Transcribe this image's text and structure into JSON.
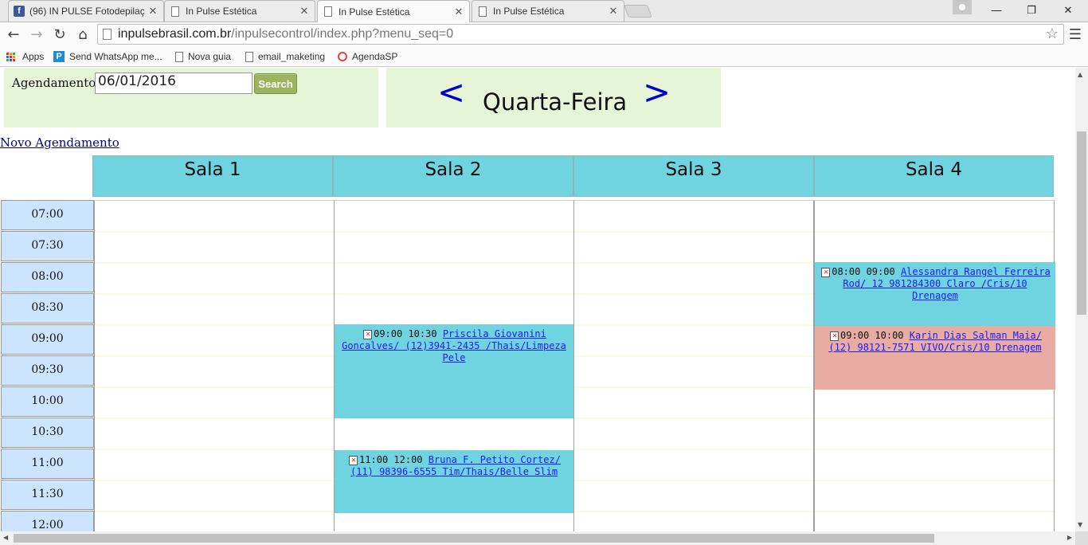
{
  "browser": {
    "tabs": [
      {
        "label": "(96) IN PULSE Fotodepilaç",
        "icon": "facebook-icon",
        "active": false
      },
      {
        "label": "In Pulse Estética",
        "icon": "page-icon",
        "active": false
      },
      {
        "label": "In Pulse Estética",
        "icon": "page-icon",
        "active": true
      },
      {
        "label": "In Pulse Estética",
        "icon": "page-icon",
        "active": false
      }
    ],
    "url_domain": "inpulsebrasil.com.br",
    "url_path": "/inpulsecontrol/index.php?menu_seq=0",
    "bookmarks": [
      {
        "label": "Apps",
        "icon": "apps-icon"
      },
      {
        "label": "Send WhatsApp me...",
        "icon": "p-icon"
      },
      {
        "label": "Nova guia",
        "icon": "page-icon"
      },
      {
        "label": "email_maketing",
        "icon": "page-icon"
      },
      {
        "label": "AgendaSP",
        "icon": "clock-icon"
      }
    ]
  },
  "search": {
    "label": "Agendamento:",
    "date_value": "06/01/2016",
    "button": "Search"
  },
  "day_nav": {
    "prev": "<",
    "day": "Quarta-Feira",
    "next": ">"
  },
  "new_link": "Novo Agendamento",
  "rooms": [
    "Sala 1",
    "Sala 2",
    "Sala 3",
    "Sala 4"
  ],
  "times": [
    "07:00",
    "07:30",
    "08:00",
    "08:30",
    "09:00",
    "09:30",
    "10:00",
    "10:30",
    "11:00",
    "11:30",
    "12:00"
  ],
  "appointments": [
    {
      "room": "Sala 2",
      "start": "09:00",
      "end": "10:30",
      "time_text": "09:00 10:30",
      "link_text": "Priscila Giovanini Goncalves/ (12)3941-2435 /Thais/Limpeza Pele",
      "color": "#70d4e0"
    },
    {
      "room": "Sala 2",
      "start": "11:00",
      "end": "12:00",
      "time_text": "11:00 12:00",
      "link_text": "Bruna F. Petito Cortez/ (11) 98396-6555 Tim/Thais/Belle Slim",
      "color": "#70d4e0"
    },
    {
      "room": "Sala 4",
      "start": "08:00",
      "end": "09:00",
      "time_text": "08:00 09:00",
      "link_text": "Alessandra Rangel Ferreira Rod/ 12 981284300 Claro /Cris/10 Drenagem",
      "color": "#70d4e0"
    },
    {
      "room": "Sala 4",
      "start": "09:00",
      "end": "10:00",
      "time_text": "09:00 10:00",
      "link_text": "Karin Dias Salman Maia/ (12) 98121-7571 VIVO/Cris/10 Drenagem",
      "color": "#e8aca3"
    }
  ]
}
